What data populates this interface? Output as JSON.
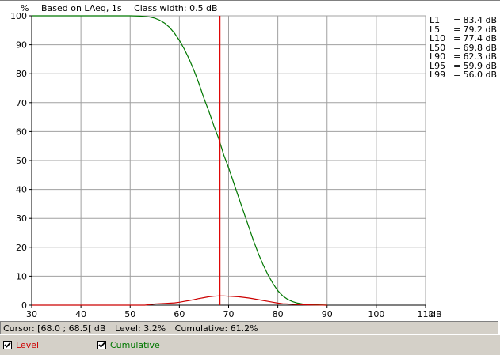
{
  "header": {
    "y_unit": "%",
    "basis": "Based on LAeq, 1s",
    "class_width": "Class width: 0.5 dB"
  },
  "stats": [
    {
      "name": "L1",
      "eq": "=",
      "value": "83.4 dB"
    },
    {
      "name": "L5",
      "eq": "=",
      "value": "79.2 dB"
    },
    {
      "name": "L10",
      "eq": "=",
      "value": "77.4 dB"
    },
    {
      "name": "L50",
      "eq": "=",
      "value": "69.8 dB"
    },
    {
      "name": "L90",
      "eq": "=",
      "value": "62.3 dB"
    },
    {
      "name": "L95",
      "eq": "=",
      "value": "59.9 dB"
    },
    {
      "name": "L99",
      "eq": "=",
      "value": "56.0 dB"
    }
  ],
  "status": {
    "cursor": "Cursor: [68.0 ; 68.5[ dB",
    "level": "Level: 3.2%",
    "cumulative": "Cumulative: 61.2%"
  },
  "legend": {
    "level_label": "Level",
    "level_checked": true,
    "cumulative_label": "Cumulative",
    "cumulative_checked": true
  },
  "colors": {
    "level": "#cc0000",
    "cumulative": "#007700",
    "cursor": "#dd0000",
    "grid": "#a0a0a0"
  },
  "chart_data": {
    "type": "line",
    "xlabel_unit": "dB",
    "xlim": [
      30,
      110
    ],
    "ylim": [
      0,
      100
    ],
    "x_ticks": [
      30,
      40,
      50,
      60,
      70,
      80,
      90,
      100,
      110
    ],
    "y_ticks": [
      0,
      10,
      20,
      30,
      40,
      50,
      60,
      70,
      80,
      90,
      100
    ],
    "grid": true,
    "cursor_x": 68.25,
    "series": [
      {
        "name": "Cumulative",
        "color": "#007700",
        "x": [
          30,
          50,
          52,
          54,
          55,
          56,
          57,
          58,
          59,
          60,
          61,
          62,
          63,
          64,
          65,
          66,
          67,
          68,
          69,
          70,
          71,
          72,
          73,
          74,
          75,
          76,
          77,
          78,
          79,
          80,
          81,
          82,
          83,
          84,
          85,
          86,
          88,
          90
        ],
        "values": [
          100,
          100,
          99.9,
          99.6,
          99.2,
          98.5,
          97.5,
          96,
          94,
          91.5,
          88.5,
          85,
          81,
          76.5,
          71.5,
          67,
          62,
          57.5,
          52,
          47.5,
          42.5,
          37.5,
          32.5,
          27.5,
          22.5,
          18,
          14,
          10.5,
          7.5,
          5,
          3.2,
          2,
          1.2,
          0.7,
          0.4,
          0.2,
          0.1,
          0
        ]
      },
      {
        "name": "Level",
        "color": "#cc0000",
        "x": [
          30,
          53,
          55,
          57,
          59,
          60,
          61,
          62,
          63,
          64,
          65,
          66,
          67,
          68,
          69,
          70,
          71,
          72,
          73,
          74,
          75,
          76,
          77,
          78,
          79,
          80,
          81,
          82,
          84,
          86,
          88,
          90
        ],
        "values": [
          0,
          0,
          0.4,
          0.6,
          0.8,
          1.0,
          1.3,
          1.6,
          1.9,
          2.3,
          2.6,
          2.9,
          3.1,
          3.2,
          3.2,
          3.1,
          3.0,
          2.9,
          2.7,
          2.5,
          2.2,
          1.9,
          1.6,
          1.3,
          1.0,
          0.7,
          0.5,
          0.4,
          0.2,
          0.1,
          0.05,
          0
        ]
      }
    ]
  }
}
